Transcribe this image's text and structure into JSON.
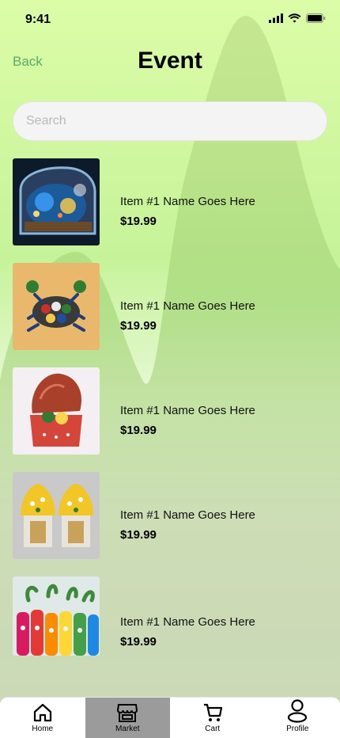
{
  "status_bar": {
    "time": "9:41"
  },
  "header": {
    "back_label": "Back",
    "title": "Event"
  },
  "search": {
    "placeholder": "Search",
    "value": ""
  },
  "items": [
    {
      "name": "Item #1 Name Goes Here",
      "price": "$19.99"
    },
    {
      "name": "Item #1 Name Goes Here",
      "price": "$19.99"
    },
    {
      "name": "Item #1 Name Goes Here",
      "price": "$19.99"
    },
    {
      "name": "Item #1 Name Goes Here",
      "price": "$19.99"
    },
    {
      "name": "Item #1 Name Goes Here",
      "price": "$19.99"
    }
  ],
  "tabs": [
    {
      "label": "Home",
      "icon": "home-icon"
    },
    {
      "label": "Market",
      "icon": "store-icon",
      "active": true
    },
    {
      "label": "Cart",
      "icon": "cart-icon"
    },
    {
      "label": "Profile",
      "icon": "profile-icon"
    }
  ],
  "colors": {
    "accent": "#5aa86a",
    "bg_top": "#d8f8a8",
    "bg_bottom": "#d6dfc2",
    "active_tab": "#9b9b9b"
  }
}
